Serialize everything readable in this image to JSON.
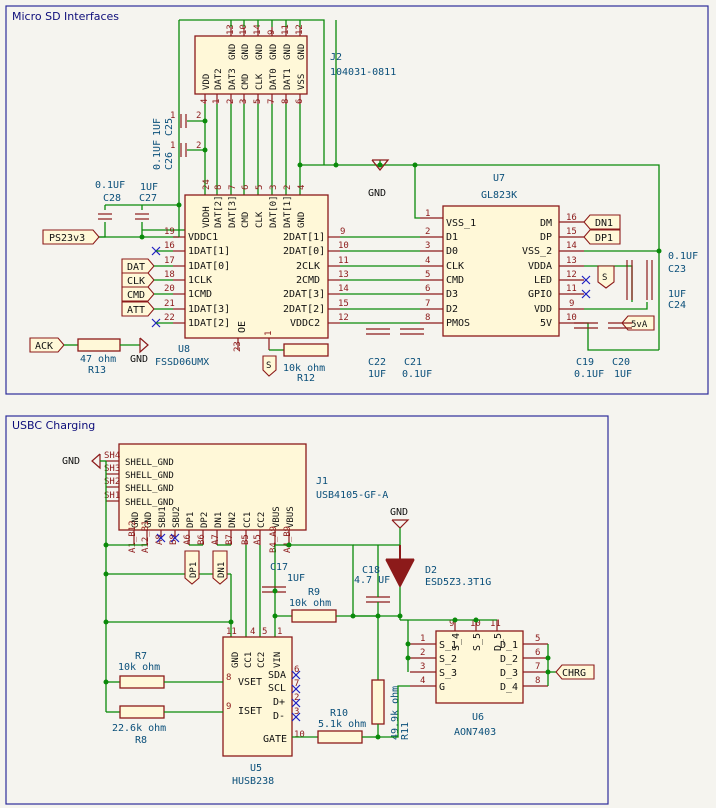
{
  "sections": {
    "microsd_title": "Micro SD Interfaces",
    "usbc_title": "USBC Charging"
  },
  "j2": {
    "ref": "J2",
    "value": "104031-0811",
    "pins": [
      {
        "name": "VDD",
        "num": "4"
      },
      {
        "name": "DAT2",
        "num": "1"
      },
      {
        "name": "DAT3",
        "num": "2"
      },
      {
        "name": "CMD",
        "num": "3"
      },
      {
        "name": "CLK",
        "num": "5"
      },
      {
        "name": "DAT0",
        "num": "7"
      },
      {
        "name": "DAT1",
        "num": "8"
      },
      {
        "name": "VSS",
        "num": "6"
      }
    ],
    "gnd_pins": [
      {
        "name": "GND",
        "num": "13"
      },
      {
        "name": "GND",
        "num": "10"
      },
      {
        "name": "GND",
        "num": "14"
      },
      {
        "name": "GND",
        "num": "9"
      },
      {
        "name": "GND",
        "num": "11"
      },
      {
        "name": "GND",
        "num": "12"
      }
    ]
  },
  "u8": {
    "ref": "U8",
    "value": "FSSD06UMX",
    "top_pins": [
      {
        "name": "VDDH",
        "num": "24"
      },
      {
        "name": "DAT[2]",
        "num": "8"
      },
      {
        "name": "DAT[3]",
        "num": "7"
      },
      {
        "name": "CMD",
        "num": "6"
      },
      {
        "name": "CLK",
        "num": "5"
      },
      {
        "name": "DAT[0]",
        "num": "3"
      },
      {
        "name": "DAT[1]",
        "num": "2"
      },
      {
        "name": "GND",
        "num": "4"
      }
    ],
    "left_pins": [
      {
        "name": "VDDC1",
        "num": "19"
      },
      {
        "name": "1DAT[1]",
        "num": "16"
      },
      {
        "name": "1DAT[0]",
        "num": "17"
      },
      {
        "name": "1CLK",
        "num": "18"
      },
      {
        "name": "1CMD",
        "num": "20"
      },
      {
        "name": "1DAT[3]",
        "num": "21"
      },
      {
        "name": "1DAT[2]",
        "num": "22"
      }
    ],
    "right_pins": [
      {
        "name": "2DAT[1]",
        "num": "9"
      },
      {
        "name": "2DAT[0]",
        "num": "10"
      },
      {
        "name": "2CLK",
        "num": "11"
      },
      {
        "name": "2CMD",
        "num": "13"
      },
      {
        "name": "2DAT[3]",
        "num": "14"
      },
      {
        "name": "2DAT[2]",
        "num": "15"
      },
      {
        "name": "VDDC2",
        "num": "12"
      }
    ],
    "bottom_pins": [
      {
        "name": "OE",
        "num": "1"
      },
      {
        "name": "S",
        "num": "23"
      }
    ]
  },
  "u7": {
    "ref": "U7",
    "value": "GL823K",
    "left_pins": [
      {
        "name": "VSS_1",
        "num": "1"
      },
      {
        "name": "D1",
        "num": "2"
      },
      {
        "name": "D0",
        "num": "3"
      },
      {
        "name": "CLK",
        "num": "4"
      },
      {
        "name": "CMD",
        "num": "5"
      },
      {
        "name": "D3",
        "num": "6"
      },
      {
        "name": "D2",
        "num": "7"
      },
      {
        "name": "PMOS",
        "num": "8"
      }
    ],
    "right_pins": [
      {
        "name": "DM",
        "num": "16"
      },
      {
        "name": "DP",
        "num": "15"
      },
      {
        "name": "VSS_2",
        "num": "14"
      },
      {
        "name": "VDDA",
        "num": "13"
      },
      {
        "name": "LED",
        "num": "12"
      },
      {
        "name": "GPIO",
        "num": "11"
      },
      {
        "name": "VDD",
        "num": "9"
      },
      {
        "name": "5V",
        "num": "10"
      }
    ]
  },
  "caps_top": [
    {
      "ref": "C25",
      "value": "1UF"
    },
    {
      "ref": "C26",
      "value": "0.1UF"
    },
    {
      "ref": "C28",
      "value": "0.1UF"
    },
    {
      "ref": "C27",
      "value": "1UF"
    },
    {
      "ref": "C22",
      "value": "1UF"
    },
    {
      "ref": "C21",
      "value": "0.1UF"
    },
    {
      "ref": "C19",
      "value": "0.1UF"
    },
    {
      "ref": "C20",
      "value": "1UF"
    },
    {
      "ref": "C23",
      "value": "0.1UF"
    },
    {
      "ref": "C24",
      "value": "1UF"
    }
  ],
  "resistors_top": [
    {
      "ref": "R13",
      "value": "47 ohm"
    },
    {
      "ref": "R12",
      "value": "10k ohm"
    }
  ],
  "labels_top": {
    "ps23v3": "PS23v3",
    "dat": "DAT",
    "clk": "CLK",
    "cmd": "CMD",
    "att": "ATT",
    "ack": "ACK",
    "dn1": "DN1",
    "dp1": "DP1",
    "s": "S",
    "s_small": "S",
    "sva": "5vA",
    "gnd": "GND"
  },
  "j1": {
    "ref": "J1",
    "value": "USB4105-GF-A",
    "shell_pins": [
      {
        "name": "SHELL_GND",
        "num": "SH4"
      },
      {
        "name": "SHELL_GND",
        "num": "SH3"
      },
      {
        "name": "SHELL_GND",
        "num": "SH2"
      },
      {
        "name": "SHELL_GND",
        "num": "SH1"
      }
    ],
    "bottom_pins": [
      {
        "name": "GND",
        "num": "A1_B12"
      },
      {
        "name": "GND",
        "num": "A12_B1"
      },
      {
        "name": "SBU1",
        "num": "A8"
      },
      {
        "name": "SBU2",
        "num": "B8"
      },
      {
        "name": "DP1",
        "num": "A6"
      },
      {
        "name": "DP2",
        "num": "B6"
      },
      {
        "name": "DN1",
        "num": "A7"
      },
      {
        "name": "DN2",
        "num": "B7"
      },
      {
        "name": "CC1",
        "num": "A5"
      },
      {
        "name": "CC2",
        "num": "B5"
      },
      {
        "name": "VBUS",
        "num": "B4_A9"
      },
      {
        "name": "VBUS",
        "num": "A4_B9"
      }
    ]
  },
  "u5": {
    "ref": "U5",
    "value": "HUSB238",
    "top_pins": [
      {
        "name": "GND",
        "num": "11"
      },
      {
        "name": "CC1",
        "num": "4"
      },
      {
        "name": "CC2",
        "num": "5"
      },
      {
        "name": "VIN",
        "num": "1"
      }
    ],
    "left_pins": [
      {
        "name": "VSET",
        "num": "8"
      },
      {
        "name": "ISET",
        "num": "9"
      }
    ],
    "right_pins": [
      {
        "name": "SDA",
        "num": "6"
      },
      {
        "name": "SCL",
        "num": "7"
      },
      {
        "name": "D+",
        "num": "2"
      },
      {
        "name": "D-",
        "num": "3"
      },
      {
        "name": "GATE",
        "num": "10"
      }
    ]
  },
  "u6": {
    "ref": "U6",
    "value": "AON7403",
    "left_pins": [
      {
        "name": "S_1",
        "num": "1"
      },
      {
        "name": "S_2",
        "num": "2"
      },
      {
        "name": "S_3",
        "num": "3"
      },
      {
        "name": "G",
        "num": "4"
      }
    ],
    "right_pins": [
      {
        "name": "D_1",
        "num": "5"
      },
      {
        "name": "D_2",
        "num": "6"
      },
      {
        "name": "D_3",
        "num": "7"
      },
      {
        "name": "D_4",
        "num": "8"
      }
    ],
    "top_pins": [
      {
        "name": "S_4",
        "num": "9"
      },
      {
        "name": "S_5",
        "num": "10"
      },
      {
        "name": "D_5",
        "num": "11"
      }
    ]
  },
  "d2": {
    "ref": "D2",
    "value": "ESD5Z3.3T1G"
  },
  "parts_bottom": [
    {
      "ref": "C17",
      "value": "1UF"
    },
    {
      "ref": "C18",
      "value": "4.7 UF"
    },
    {
      "ref": "R9",
      "value": "10k ohm"
    },
    {
      "ref": "R7",
      "value": "10k ohm"
    },
    {
      "ref": "R8",
      "value": "22.6k ohm"
    },
    {
      "ref": "R10",
      "value": "5.1k ohm"
    },
    {
      "ref": "R11",
      "value": "49.9k ohm"
    }
  ],
  "labels_bottom": {
    "gnd1": "GND",
    "gnd2": "GND",
    "dp1": "DP1",
    "dn1": "DN1",
    "chrg": "CHRG"
  }
}
